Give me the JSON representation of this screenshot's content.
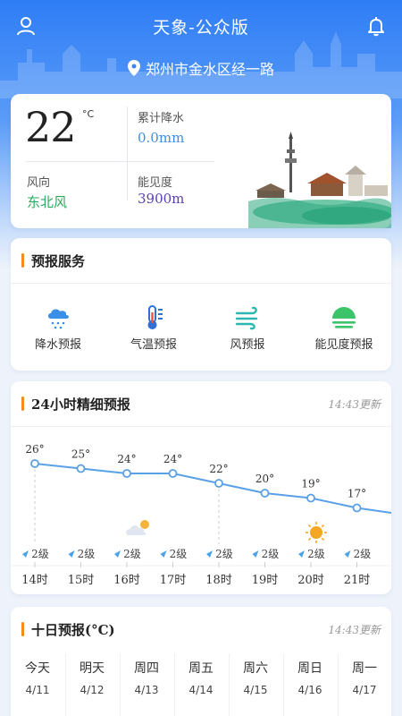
{
  "app": {
    "title": "天象-公众版"
  },
  "location": {
    "text": "郑州市金水区经一路"
  },
  "current": {
    "temp": "22",
    "temp_unit": "°C",
    "precip_label": "累计降水",
    "precip_value": "0.0mm",
    "wind_label": "风向",
    "wind_value": "东北风",
    "visibility_label": "能见度",
    "visibility_value": "3900m"
  },
  "service": {
    "title": "预报服务",
    "items": [
      {
        "label": "降水预报",
        "icon": "rain-cloud-icon"
      },
      {
        "label": "气温预报",
        "icon": "thermometer-icon"
      },
      {
        "label": "风预报",
        "icon": "wind-icon"
      },
      {
        "label": "能见度预报",
        "icon": "fog-sun-icon"
      }
    ]
  },
  "hourly": {
    "title": "24小时精细预报",
    "update": "14:43更新",
    "hours": [
      {
        "time": "14时",
        "temp": "26°",
        "wind": "2级"
      },
      {
        "time": "15时",
        "temp": "25°",
        "wind": "2级"
      },
      {
        "time": "16时",
        "temp": "24°",
        "wind": "2级"
      },
      {
        "time": "17时",
        "temp": "24°",
        "wind": "2级"
      },
      {
        "time": "18时",
        "temp": "22°",
        "wind": "2级"
      },
      {
        "time": "19时",
        "temp": "20°",
        "wind": "2级"
      },
      {
        "time": "20时",
        "temp": "19°",
        "wind": "2级"
      },
      {
        "time": "21时",
        "temp": "17°",
        "wind": "2级"
      }
    ],
    "extra_wind": "2级"
  },
  "chart_data": {
    "type": "line",
    "categories": [
      "14时",
      "15时",
      "16时",
      "17时",
      "18时",
      "19时",
      "20时",
      "21时"
    ],
    "values": [
      26,
      25,
      24,
      24,
      22,
      20,
      19,
      17
    ],
    "ylim": [
      10,
      30
    ]
  },
  "tenday": {
    "title": "十日预报(°C)",
    "update": "14:43更新",
    "days": [
      {
        "name": "今天",
        "date": "4/11"
      },
      {
        "name": "明天",
        "date": "4/12"
      },
      {
        "name": "周四",
        "date": "4/13"
      },
      {
        "name": "周五",
        "date": "4/14"
      },
      {
        "name": "周六",
        "date": "4/15"
      },
      {
        "name": "周日",
        "date": "4/16"
      },
      {
        "name": "周一",
        "date": "4/17"
      }
    ]
  },
  "colors": {
    "accent": "#2f7df6",
    "wind_green": "#2aa85a",
    "visibility_purple": "#5a3fb0",
    "precip_blue": "#3a8fe8",
    "section_bar": "#f58a1f",
    "chart_line": "#5aa0e6"
  }
}
